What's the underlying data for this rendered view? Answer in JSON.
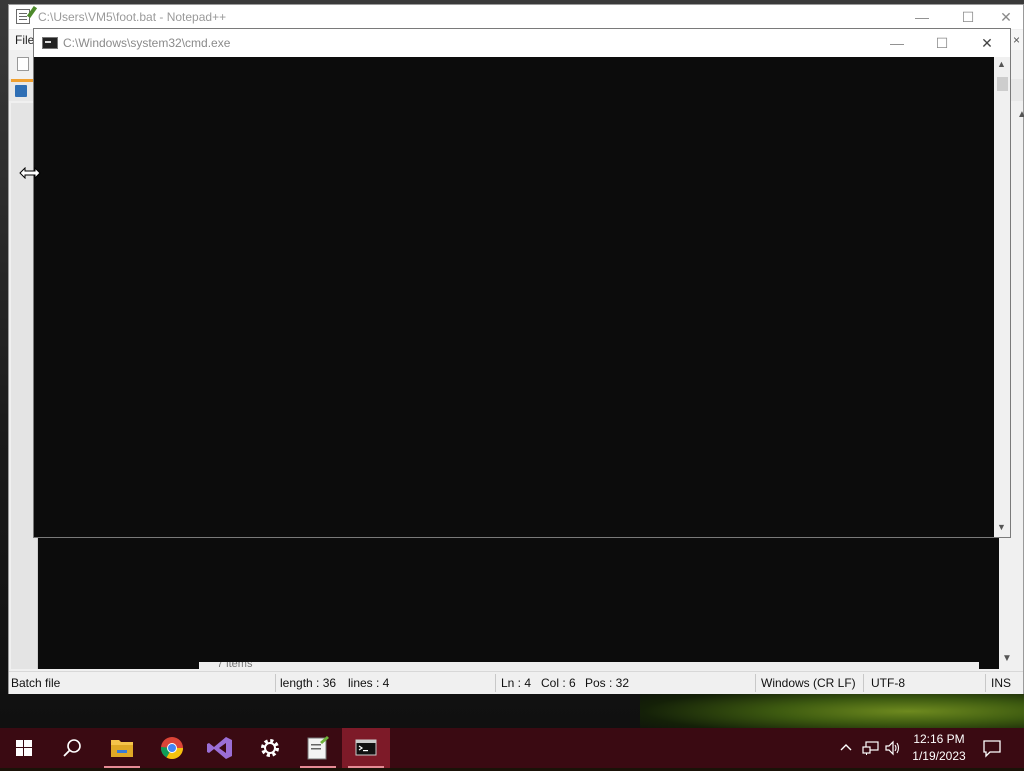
{
  "notepadpp": {
    "title": "C:\\Users\\VM5\\foot.bat - Notepad++",
    "menu_file": "File",
    "menu_close_glyph": "×",
    "status": {
      "filetype": "Batch file",
      "length": "length : 36",
      "lines": "lines : 4",
      "ln": "Ln : 4",
      "col": "Col : 6",
      "pos": "Pos : 32",
      "eol": "Windows (CR LF)",
      "encoding": "UTF-8",
      "mode": "INS"
    },
    "items_strip": "7 items"
  },
  "cmd": {
    "title": "C:\\Windows\\system32\\cmd.exe"
  },
  "window_controls": {
    "minimize": "—",
    "maximize": "☐",
    "close": "✕"
  },
  "taskbar": {
    "items": [
      {
        "name": "start",
        "icon": "windows-logo-icon"
      },
      {
        "name": "search",
        "icon": "search-icon"
      },
      {
        "name": "file-explorer",
        "icon": "folder-icon"
      },
      {
        "name": "chrome",
        "icon": "chrome-icon"
      },
      {
        "name": "visual-studio",
        "icon": "visual-studio-icon"
      },
      {
        "name": "settings",
        "icon": "gear-icon"
      },
      {
        "name": "notepadpp",
        "icon": "notepadpp-icon"
      },
      {
        "name": "cmd",
        "icon": "terminal-icon",
        "active": true
      }
    ],
    "time": "12:16 PM",
    "date": "1/19/2023"
  },
  "colors": {
    "taskbar": "#3a0a12",
    "taskbar_active": "#7d1a28",
    "console_bg": "#0c0c0c"
  }
}
